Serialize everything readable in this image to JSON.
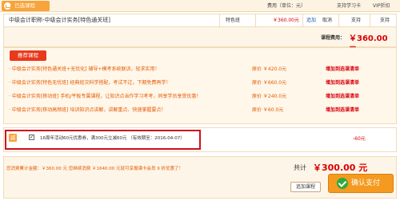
{
  "header": {
    "tab_label": "已选课程",
    "col_fee": "费用（单位：元）",
    "col_study_card": "支持学习卡",
    "col_vip": "VIP折扣"
  },
  "course": {
    "name": "中级会计职称-中级会计实务[特色通关班]",
    "class_type": "特色班",
    "price": "￥360.00元",
    "add_link": "追加",
    "cancel_link": "取消",
    "study_card": "支持",
    "vip": "支持"
  },
  "fee": {
    "label": "课程费用：",
    "value": "￥360.00 元"
  },
  "recommend": {
    "button_label": "推荐课程",
    "items": [
      {
        "text": "· 中级会计实务[特色通关班+无忧化]  辅导+模考系统联训，轻求实用！",
        "price": "原价 ￥420.0元",
        "add": "增加到选课清单"
      },
      {
        "text": "· 中级会计实务[特色无忧班]  经典班次科学搭配，考试不过，下期免费再学！",
        "price": "原价 ￥660.0元",
        "add": "增加到选课清单"
      },
      {
        "text": "· 中级会计实务[移动班]  手机/平板专属课程，让知识点当作学习考考，同享学员享受优惠！",
        "price": "原价 ￥240.0元",
        "add": "增加到选课清单"
      },
      {
        "text": "· 中级会计实务[移动高频班]  培训知识点讲解，讲解重点、快速掌握要点！",
        "price": "原价 ￥60.0元",
        "add": "增加到选课清单"
      }
    ]
  },
  "coupon": {
    "badge": "减",
    "checkbox_mark": "✓",
    "text": "16周年活动60元优惠券，满300元立减60元  （有效期至：2016-04-07）",
    "discount": "-60元"
  },
  "footer": {
    "summary": "您消费累计金额：￥360.00 元  您继续消费 ￥1640.00 元就可享报课卡会员 9 折优惠了！",
    "total_label": "共计",
    "total_value": "￥300.00 元",
    "more_button": "追加课程",
    "pay_button": "确认支付"
  },
  "colors": {
    "accent": "#f7a43a",
    "price_red": "#d80000",
    "highlight_border": "#d0101a",
    "pay_icon": "#2faa3c"
  }
}
